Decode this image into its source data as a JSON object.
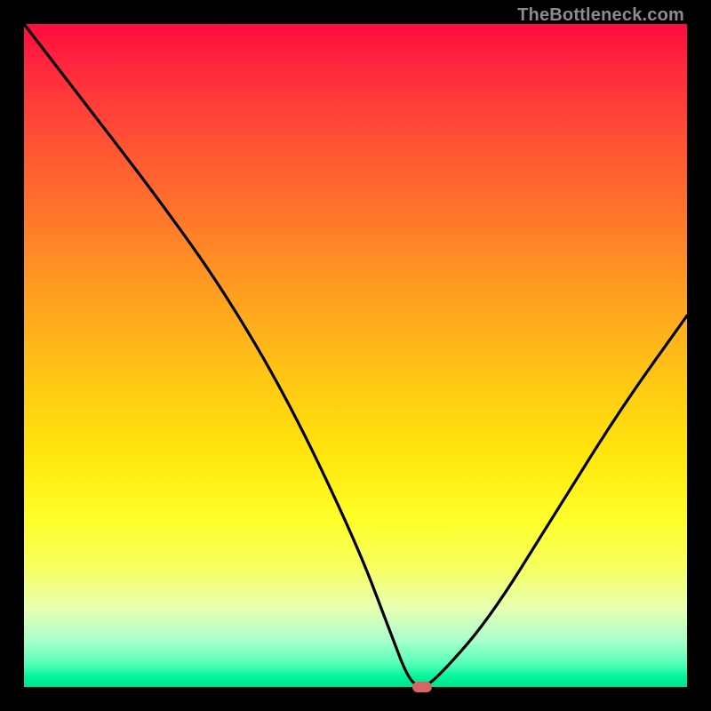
{
  "watermark": "TheBottleneck.com",
  "chart_data": {
    "type": "line",
    "title": "",
    "xlabel": "",
    "ylabel": "",
    "xlim": [
      0,
      100
    ],
    "ylim": [
      0,
      100
    ],
    "grid": false,
    "legend": false,
    "series": [
      {
        "name": "bottleneck-curve",
        "color": "#000000",
        "x": [
          0,
          10,
          20,
          30,
          40,
          50,
          55,
          58,
          60,
          62,
          70,
          80,
          90,
          100
        ],
        "y": [
          100,
          87,
          74,
          60,
          43,
          22,
          9,
          1,
          0,
          1,
          10,
          26,
          42,
          56
        ]
      }
    ],
    "annotations": [
      {
        "name": "min-marker",
        "x": 60,
        "y": 0,
        "shape": "pill",
        "color": "#d96464"
      }
    ],
    "background_gradient": {
      "direction": "vertical",
      "stops": [
        {
          "pos": 0.0,
          "color": "#ff0b40"
        },
        {
          "pos": 0.5,
          "color": "#ffc814"
        },
        {
          "pos": 0.8,
          "color": "#ffff60"
        },
        {
          "pos": 1.0,
          "color": "#00e28a"
        }
      ]
    }
  }
}
